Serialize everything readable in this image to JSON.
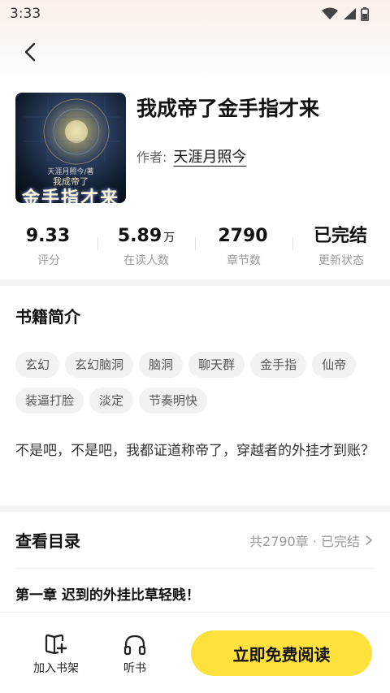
{
  "status_bar": {
    "time": "3:33"
  },
  "book": {
    "title": "我成帝了金手指才来",
    "author_label": "作者:",
    "author_name": "天涯月照今",
    "cover": {
      "line1": "天涯月照今/著",
      "line2": "我成帝了",
      "title": "金手指才来"
    }
  },
  "stats": [
    {
      "value": "9.33",
      "unit": "",
      "label": "评分"
    },
    {
      "value": "5.89",
      "unit": "万",
      "label": "在读人数"
    },
    {
      "value": "2790",
      "unit": "",
      "label": "章节数"
    },
    {
      "value": "已完结",
      "unit": "",
      "label": "更新状态"
    }
  ],
  "intro": {
    "title": "书籍简介",
    "tags": [
      "玄幻",
      "玄幻脑洞",
      "脑洞",
      "聊天群",
      "金手指",
      "仙帝",
      "装逼打脸",
      "淡定",
      "节奏明快"
    ],
    "description": "不是吧，不是吧，我都证道称帝了，穿越者的外挂才到账？"
  },
  "catalog": {
    "title": "查看目录",
    "meta": "共2790章 · 已完结",
    "first_chapter": "第一章 迟到的外挂比草轻贱！"
  },
  "bottom_bar": {
    "add_shelf_label": "加入书架",
    "listen_label": "听书",
    "read_button_label": "立即免费阅读"
  },
  "colors": {
    "accent": "#ffe13d"
  }
}
